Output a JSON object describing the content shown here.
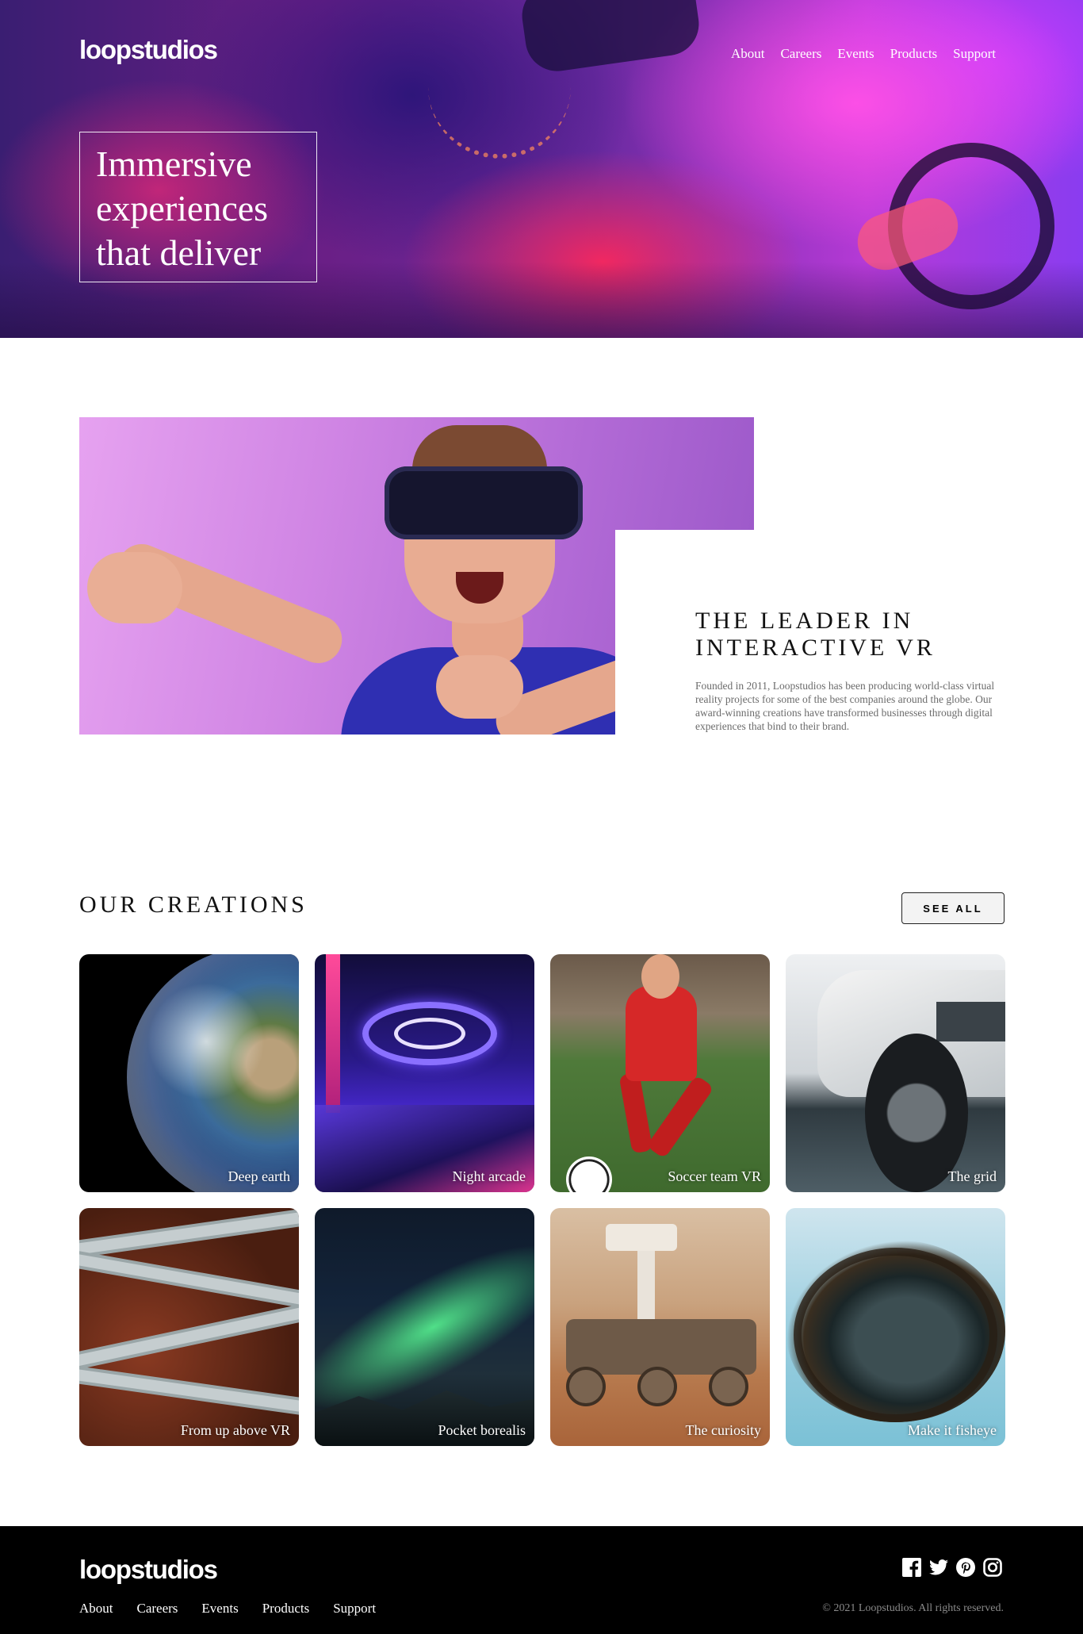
{
  "brand": {
    "logo_text": "loopstudios"
  },
  "header": {
    "nav": [
      {
        "label": "About"
      },
      {
        "label": "Careers"
      },
      {
        "label": "Events"
      },
      {
        "label": "Products"
      },
      {
        "label": "Support"
      }
    ]
  },
  "hero": {
    "headline": "Immersive experiences that deliver"
  },
  "about": {
    "heading": "The leader in interactive VR",
    "body": "Founded in 2011, Loopstudios has been producing world-class virtual reality projects for some of the best companies around the globe. Our award-winning creations have transformed businesses through digital experiences that bind to their brand."
  },
  "creations": {
    "title": "Our creations",
    "see_all_label": "See all",
    "items": [
      {
        "label": "Deep earth"
      },
      {
        "label": "Night arcade"
      },
      {
        "label": "Soccer team VR"
      },
      {
        "label": "The grid"
      },
      {
        "label": "From up above VR"
      },
      {
        "label": "Pocket borealis"
      },
      {
        "label": "The curiosity"
      },
      {
        "label": "Make it fisheye"
      }
    ]
  },
  "footer": {
    "nav": [
      {
        "label": "About"
      },
      {
        "label": "Careers"
      },
      {
        "label": "Events"
      },
      {
        "label": "Products"
      },
      {
        "label": "Support"
      }
    ],
    "social_icons": [
      "facebook-icon",
      "twitter-icon",
      "pinterest-icon",
      "instagram-icon"
    ],
    "copyright": "© 2021 Loopstudios. All rights reserved."
  },
  "colors": {
    "footer_bg": "#000000",
    "text_muted": "#6b6b6b",
    "hero_accent": "#ff4fd8"
  }
}
